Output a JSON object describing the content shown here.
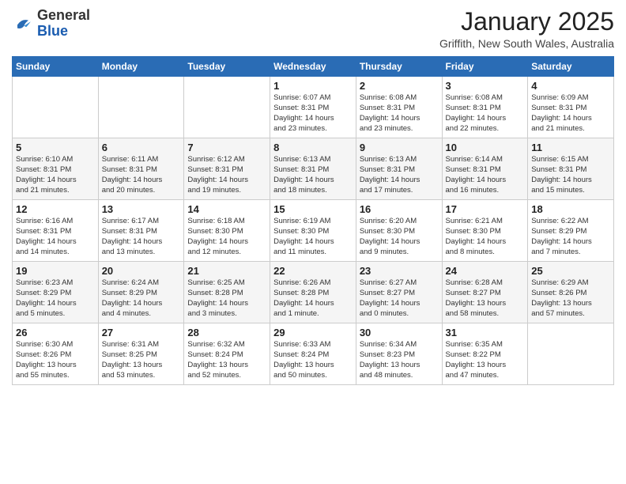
{
  "logo": {
    "general": "General",
    "blue": "Blue"
  },
  "header": {
    "title": "January 2025",
    "subtitle": "Griffith, New South Wales, Australia"
  },
  "weekdays": [
    "Sunday",
    "Monday",
    "Tuesday",
    "Wednesday",
    "Thursday",
    "Friday",
    "Saturday"
  ],
  "weeks": [
    [
      {
        "day": "",
        "info": ""
      },
      {
        "day": "",
        "info": ""
      },
      {
        "day": "",
        "info": ""
      },
      {
        "day": "1",
        "info": "Sunrise: 6:07 AM\nSunset: 8:31 PM\nDaylight: 14 hours\nand 23 minutes."
      },
      {
        "day": "2",
        "info": "Sunrise: 6:08 AM\nSunset: 8:31 PM\nDaylight: 14 hours\nand 23 minutes."
      },
      {
        "day": "3",
        "info": "Sunrise: 6:08 AM\nSunset: 8:31 PM\nDaylight: 14 hours\nand 22 minutes."
      },
      {
        "day": "4",
        "info": "Sunrise: 6:09 AM\nSunset: 8:31 PM\nDaylight: 14 hours\nand 21 minutes."
      }
    ],
    [
      {
        "day": "5",
        "info": "Sunrise: 6:10 AM\nSunset: 8:31 PM\nDaylight: 14 hours\nand 21 minutes."
      },
      {
        "day": "6",
        "info": "Sunrise: 6:11 AM\nSunset: 8:31 PM\nDaylight: 14 hours\nand 20 minutes."
      },
      {
        "day": "7",
        "info": "Sunrise: 6:12 AM\nSunset: 8:31 PM\nDaylight: 14 hours\nand 19 minutes."
      },
      {
        "day": "8",
        "info": "Sunrise: 6:13 AM\nSunset: 8:31 PM\nDaylight: 14 hours\nand 18 minutes."
      },
      {
        "day": "9",
        "info": "Sunrise: 6:13 AM\nSunset: 8:31 PM\nDaylight: 14 hours\nand 17 minutes."
      },
      {
        "day": "10",
        "info": "Sunrise: 6:14 AM\nSunset: 8:31 PM\nDaylight: 14 hours\nand 16 minutes."
      },
      {
        "day": "11",
        "info": "Sunrise: 6:15 AM\nSunset: 8:31 PM\nDaylight: 14 hours\nand 15 minutes."
      }
    ],
    [
      {
        "day": "12",
        "info": "Sunrise: 6:16 AM\nSunset: 8:31 PM\nDaylight: 14 hours\nand 14 minutes."
      },
      {
        "day": "13",
        "info": "Sunrise: 6:17 AM\nSunset: 8:31 PM\nDaylight: 14 hours\nand 13 minutes."
      },
      {
        "day": "14",
        "info": "Sunrise: 6:18 AM\nSunset: 8:30 PM\nDaylight: 14 hours\nand 12 minutes."
      },
      {
        "day": "15",
        "info": "Sunrise: 6:19 AM\nSunset: 8:30 PM\nDaylight: 14 hours\nand 11 minutes."
      },
      {
        "day": "16",
        "info": "Sunrise: 6:20 AM\nSunset: 8:30 PM\nDaylight: 14 hours\nand 9 minutes."
      },
      {
        "day": "17",
        "info": "Sunrise: 6:21 AM\nSunset: 8:30 PM\nDaylight: 14 hours\nand 8 minutes."
      },
      {
        "day": "18",
        "info": "Sunrise: 6:22 AM\nSunset: 8:29 PM\nDaylight: 14 hours\nand 7 minutes."
      }
    ],
    [
      {
        "day": "19",
        "info": "Sunrise: 6:23 AM\nSunset: 8:29 PM\nDaylight: 14 hours\nand 5 minutes."
      },
      {
        "day": "20",
        "info": "Sunrise: 6:24 AM\nSunset: 8:29 PM\nDaylight: 14 hours\nand 4 minutes."
      },
      {
        "day": "21",
        "info": "Sunrise: 6:25 AM\nSunset: 8:28 PM\nDaylight: 14 hours\nand 3 minutes."
      },
      {
        "day": "22",
        "info": "Sunrise: 6:26 AM\nSunset: 8:28 PM\nDaylight: 14 hours\nand 1 minute."
      },
      {
        "day": "23",
        "info": "Sunrise: 6:27 AM\nSunset: 8:27 PM\nDaylight: 14 hours\nand 0 minutes."
      },
      {
        "day": "24",
        "info": "Sunrise: 6:28 AM\nSunset: 8:27 PM\nDaylight: 13 hours\nand 58 minutes."
      },
      {
        "day": "25",
        "info": "Sunrise: 6:29 AM\nSunset: 8:26 PM\nDaylight: 13 hours\nand 57 minutes."
      }
    ],
    [
      {
        "day": "26",
        "info": "Sunrise: 6:30 AM\nSunset: 8:26 PM\nDaylight: 13 hours\nand 55 minutes."
      },
      {
        "day": "27",
        "info": "Sunrise: 6:31 AM\nSunset: 8:25 PM\nDaylight: 13 hours\nand 53 minutes."
      },
      {
        "day": "28",
        "info": "Sunrise: 6:32 AM\nSunset: 8:24 PM\nDaylight: 13 hours\nand 52 minutes."
      },
      {
        "day": "29",
        "info": "Sunrise: 6:33 AM\nSunset: 8:24 PM\nDaylight: 13 hours\nand 50 minutes."
      },
      {
        "day": "30",
        "info": "Sunrise: 6:34 AM\nSunset: 8:23 PM\nDaylight: 13 hours\nand 48 minutes."
      },
      {
        "day": "31",
        "info": "Sunrise: 6:35 AM\nSunset: 8:22 PM\nDaylight: 13 hours\nand 47 minutes."
      },
      {
        "day": "",
        "info": ""
      }
    ]
  ]
}
